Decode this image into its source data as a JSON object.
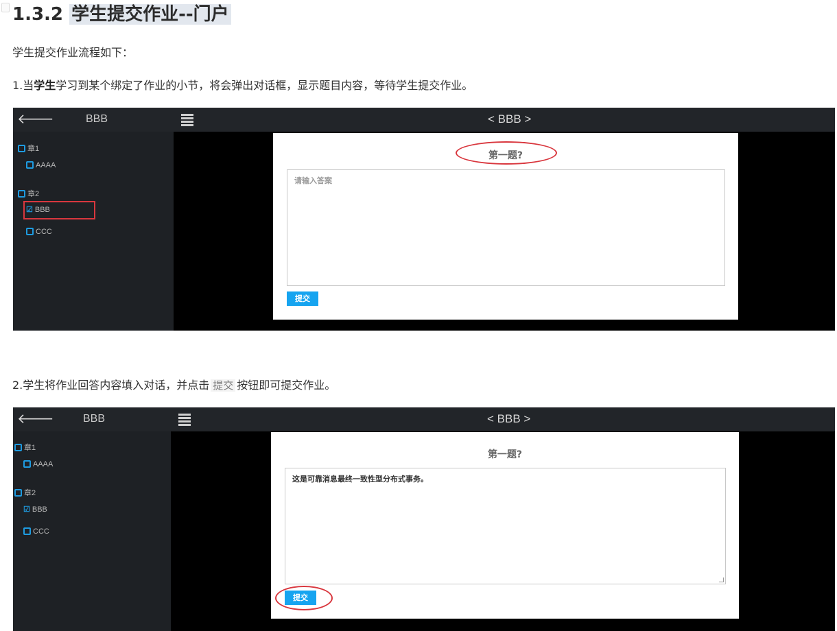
{
  "heading": {
    "number": "1.3.2",
    "title": "学生提交作业--门户"
  },
  "intro": "学生提交作业流程如下：",
  "step1": {
    "prefix": "1.当",
    "bold": "学生",
    "rest": "学习到某个绑定了作业的小节，将会弹出对话框，显示题目内容，等待学生提交作业。"
  },
  "step2": {
    "prefix": "2.学生将作业回答内容填入对话，并点击",
    "code": "提交",
    "rest": "按钮即可提交作业。"
  },
  "screen1": {
    "side_title": "BBB",
    "page_title": "< BBB >",
    "nav": [
      {
        "label": "章1"
      },
      {
        "label": "AAAA"
      },
      {
        "label": "章2"
      },
      {
        "label": "BBB"
      },
      {
        "label": "CCC"
      }
    ],
    "question": "第一题?",
    "answer_placeholder": "请输入答案",
    "submit_label": "提交"
  },
  "screen2": {
    "side_title": "BBB",
    "page_title": "< BBB >",
    "nav": [
      {
        "label": "章1"
      },
      {
        "label": "AAAA"
      },
      {
        "label": "章2"
      },
      {
        "label": "BBB"
      },
      {
        "label": "CCC"
      }
    ],
    "question": "第一题?",
    "answer_text": "这是可靠消息最终一致性型分布式事务。",
    "submit_label": "提交"
  },
  "colors": {
    "accent": "#16a4f0",
    "annotation": "#d9373e",
    "topbar": "#222529",
    "sidebar": "#1e2125"
  }
}
